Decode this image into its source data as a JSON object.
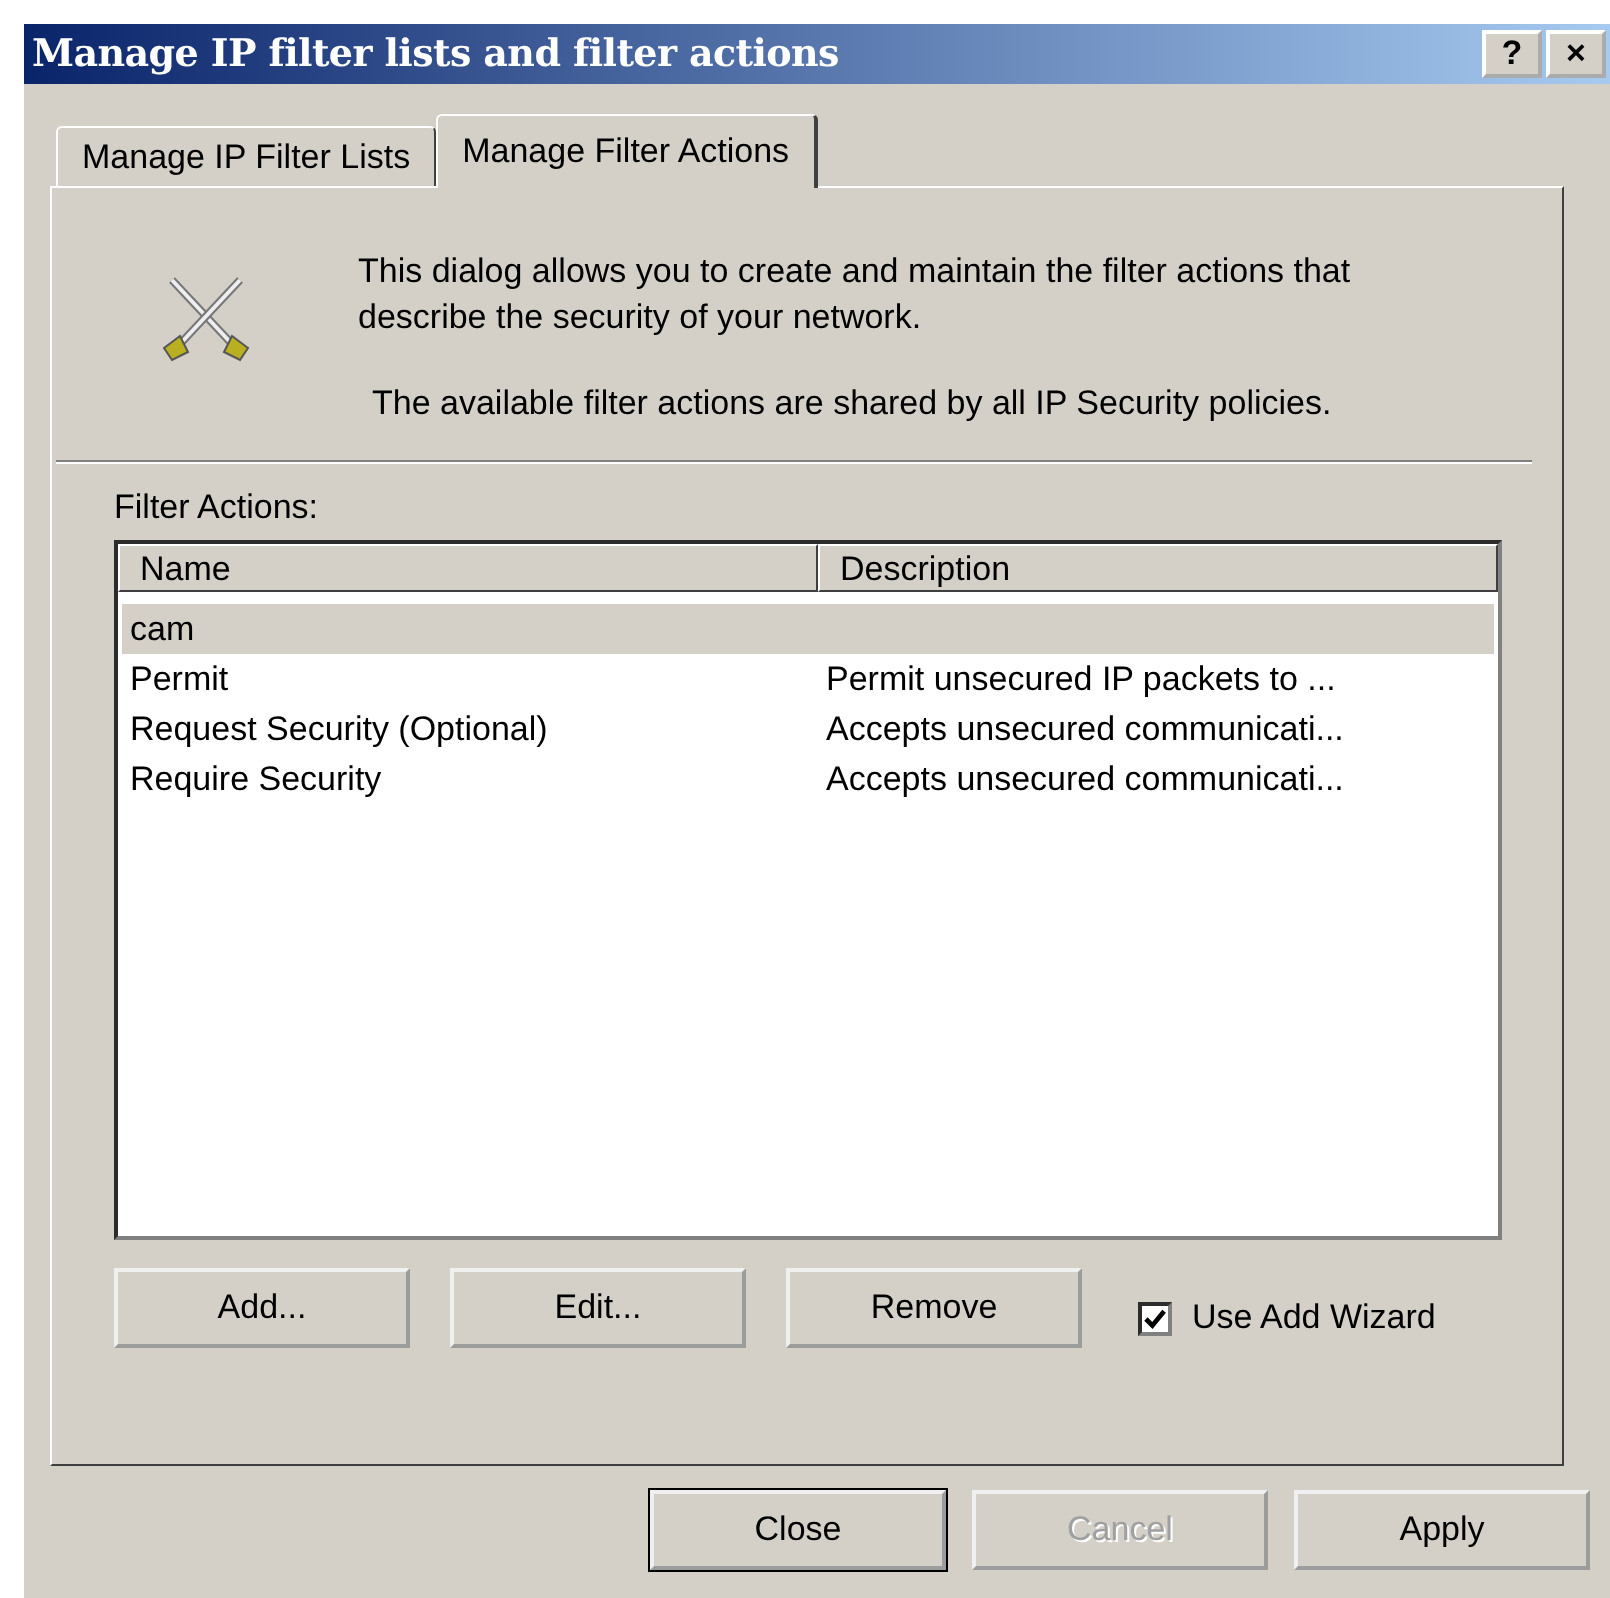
{
  "window": {
    "title": "Manage IP filter lists and filter actions",
    "help_button": "?",
    "close_button": "×"
  },
  "tabs": [
    {
      "label": "Manage IP Filter Lists",
      "selected": false
    },
    {
      "label": "Manage Filter Actions",
      "selected": true
    }
  ],
  "intro": [
    "This dialog allows you to create and maintain the filter actions that describe the security of your network.",
    "The available filter actions are shared by all IP Security policies."
  ],
  "list": {
    "label": "Filter Actions:",
    "columns": [
      "Name",
      "Description"
    ],
    "rows": [
      {
        "cells": [
          "cam",
          ""
        ],
        "selected": true
      },
      {
        "cells": [
          "Permit",
          "Permit unsecured IP packets to ..."
        ],
        "selected": false
      },
      {
        "cells": [
          "Request Security (Optional)",
          "Accepts unsecured communicati..."
        ],
        "selected": false
      },
      {
        "cells": [
          "Require Security",
          "Accepts unsecured communicati..."
        ],
        "selected": false
      }
    ]
  },
  "list_buttons": [
    "Add...",
    "Edit...",
    "Remove"
  ],
  "wizard": {
    "label": "Use Add Wizard",
    "checked": true
  },
  "footer_buttons": [
    {
      "label": "Close",
      "disabled": false,
      "default": true
    },
    {
      "label": "Cancel",
      "disabled": true,
      "default": false
    },
    {
      "label": "Apply",
      "disabled": false,
      "default": false
    }
  ]
}
